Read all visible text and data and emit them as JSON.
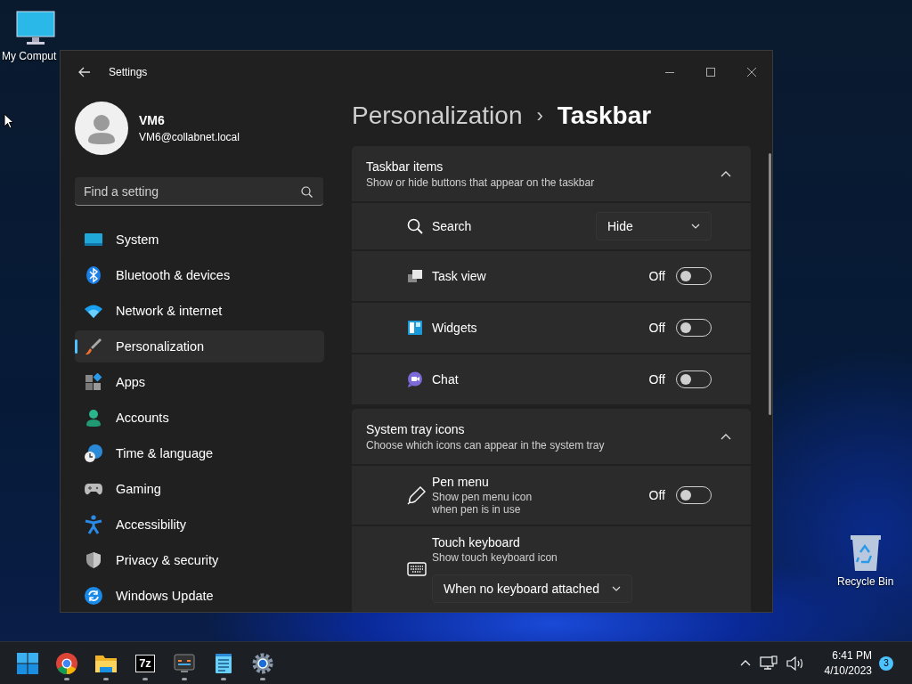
{
  "desktop_icons": [
    {
      "label": "My Comput"
    },
    {
      "label": "Recycle Bin"
    }
  ],
  "window": {
    "title": "Settings",
    "account": {
      "name": "VM6",
      "email": "VM6@collabnet.local"
    },
    "search": {
      "placeholder": "Find a setting"
    },
    "nav": [
      {
        "label": "System",
        "selected": false
      },
      {
        "label": "Bluetooth & devices",
        "selected": false
      },
      {
        "label": "Network & internet",
        "selected": false
      },
      {
        "label": "Personalization",
        "selected": true
      },
      {
        "label": "Apps",
        "selected": false
      },
      {
        "label": "Accounts",
        "selected": false
      },
      {
        "label": "Time & language",
        "selected": false
      },
      {
        "label": "Gaming",
        "selected": false
      },
      {
        "label": "Accessibility",
        "selected": false
      },
      {
        "label": "Privacy & security",
        "selected": false
      },
      {
        "label": "Windows Update",
        "selected": false
      }
    ],
    "breadcrumb": {
      "parent": "Personalization",
      "separator": "›",
      "current": "Taskbar"
    },
    "sections": [
      {
        "title": "Taskbar items",
        "subtitle": "Show or hide buttons that appear on the taskbar",
        "expanded": true,
        "items": [
          {
            "kind": "dropdown",
            "label": "Search",
            "value": "Hide"
          },
          {
            "kind": "toggle",
            "label": "Task view",
            "state_text": "Off",
            "on": false
          },
          {
            "kind": "toggle",
            "label": "Widgets",
            "state_text": "Off",
            "on": false
          },
          {
            "kind": "toggle",
            "label": "Chat",
            "state_text": "Off",
            "on": false
          }
        ]
      },
      {
        "title": "System tray icons",
        "subtitle": "Choose which icons can appear in the system tray",
        "expanded": true,
        "items": [
          {
            "kind": "toggle",
            "label": "Pen menu",
            "description": "Show pen menu icon when pen is in use",
            "state_text": "Off",
            "on": false
          },
          {
            "kind": "dropdown-below",
            "label": "Touch keyboard",
            "description": "Show touch keyboard icon",
            "value": "When no keyboard attached"
          }
        ]
      }
    ]
  },
  "taskbar": {
    "apps": [
      {
        "running": false
      },
      {
        "running": true
      },
      {
        "running": true
      },
      {
        "running": true,
        "label": "7z"
      },
      {
        "running": true
      },
      {
        "running": true
      },
      {
        "running": true
      }
    ],
    "time": "6:41 PM",
    "date": "4/10/2023",
    "notification_count": "3"
  }
}
